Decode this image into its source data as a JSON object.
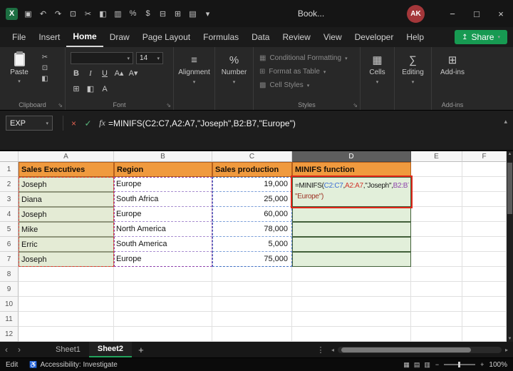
{
  "colors": {
    "header_fill": "#F09A3E",
    "header_border": "#B45F1D",
    "name_fill": "#E4EBD5",
    "result_fill": "#E2EFDA",
    "result_border": "#42603A",
    "ref_blue": "#4472C4",
    "ref_red": "#E23B2E",
    "ref_purple": "#8E44AD",
    "edit_border": "#E0261A",
    "share_green": "#179A52",
    "tab_active_green": "#23A35D",
    "avatar_red": "#A4373A"
  },
  "titlebar": {
    "app_glyph": "X",
    "workbook_name": "Book...",
    "avatar_initials": "AK",
    "window_controls": {
      "minimize": "−",
      "maximize": "□",
      "close": "×"
    },
    "qat": [
      {
        "name": "save-icon",
        "glyph": "▣"
      },
      {
        "name": "undo-icon",
        "glyph": "↶"
      },
      {
        "name": "redo-icon",
        "glyph": "↷"
      },
      {
        "name": "copy-icon",
        "glyph": "⊡"
      },
      {
        "name": "cut-icon",
        "glyph": "✂"
      },
      {
        "name": "format-painter-icon",
        "glyph": "◧"
      },
      {
        "name": "chart-icon",
        "glyph": "▥"
      },
      {
        "name": "percent-style-icon",
        "glyph": "%"
      },
      {
        "name": "currency-style-icon",
        "glyph": "$"
      },
      {
        "name": "merge-center-icon",
        "glyph": "⊟"
      },
      {
        "name": "borders-icon",
        "glyph": "⊞"
      },
      {
        "name": "table-icon",
        "glyph": "▤"
      },
      {
        "name": "more-commands-icon",
        "glyph": "▾"
      }
    ]
  },
  "menu": {
    "items": [
      "File",
      "Insert",
      "Home",
      "Draw",
      "Page Layout",
      "Formulas",
      "Data",
      "Review",
      "View",
      "Developer",
      "Help"
    ],
    "active": "Home",
    "share_label": "Share"
  },
  "ribbon": {
    "paste_label": "Paste",
    "font_name": "",
    "font_size": "14",
    "groups": {
      "clipboard": "Clipboard",
      "font": "Font",
      "alignment": "Alignment",
      "number": "Number",
      "styles": "Styles",
      "cells": "Cells",
      "editing": "Editing",
      "addins": "Add-ins"
    },
    "clipboard_icons": [
      {
        "name": "cut-icon",
        "glyph": "✂"
      },
      {
        "name": "copy-icon",
        "glyph": "⊡"
      },
      {
        "name": "format-painter-icon",
        "glyph": "◧"
      }
    ],
    "font_row2": [
      {
        "name": "bold-button",
        "glyph": "B",
        "cls": "b"
      },
      {
        "name": "italic-button",
        "glyph": "I",
        "cls": "i"
      },
      {
        "name": "underline-button",
        "glyph": "U",
        "cls": "u"
      },
      {
        "name": "increase-font-icon",
        "glyph": "A▴"
      },
      {
        "name": "decrease-font-icon",
        "glyph": "A▾"
      }
    ],
    "font_row3": [
      {
        "name": "borders-icon",
        "glyph": "⊞"
      },
      {
        "name": "fill-color-icon",
        "glyph": "◧"
      },
      {
        "name": "font-color-icon",
        "glyph": "A"
      }
    ],
    "styles_buttons": [
      "Conditional Formatting",
      "Format as Table",
      "Cell Styles"
    ],
    "addins_button": "Add-ins"
  },
  "formula_bar": {
    "name_box": "EXP",
    "formula": "=MINIFS(C2:C7,A2:A7,\"Joseph\",B2:B7,\"Europe\")"
  },
  "grid": {
    "col_headers": [
      "A",
      "B",
      "C",
      "D",
      "E",
      "F"
    ],
    "row_headers": [
      "1",
      "2",
      "3",
      "4",
      "5",
      "6",
      "7",
      "8",
      "9",
      "10",
      "11",
      "12"
    ],
    "active_column": "D",
    "header_row": {
      "A": "Sales Executives",
      "B": "Region",
      "C": "Sales production",
      "D": "MINIFS function"
    },
    "records": [
      {
        "name": "Joseph",
        "region": "Europe",
        "sales": "19,000"
      },
      {
        "name": "Diana",
        "region": "South Africa",
        "sales": "25,000"
      },
      {
        "name": "Joseph",
        "region": "Europe",
        "sales": "60,000"
      },
      {
        "name": "Mike",
        "region": "North America",
        "sales": "78,000"
      },
      {
        "name": "Erric",
        "region": "South America",
        "sales": "5,000"
      },
      {
        "name": "Joseph",
        "region": "Europe",
        "sales": "75,000"
      }
    ],
    "formula_cell": {
      "lines": [
        [
          {
            "text": "=MINIFS(",
            "color": "#1a1a1a"
          },
          {
            "text": "C2:C7",
            "color": "#3b6cd4"
          },
          {
            "text": ",",
            "color": "#1a1a1a"
          },
          {
            "text": "A2:A7",
            "color": "#d0342c"
          },
          {
            "text": ",\"Joseph\",",
            "color": "#1a1a1a"
          },
          {
            "text": "B2:B7",
            "color": "#8e44ad"
          },
          {
            "text": ",",
            "color": "#1a1a1a"
          }
        ],
        [
          {
            "text": "\"Europe\")",
            "color": "#9c3022"
          }
        ]
      ]
    }
  },
  "sheet_tabs": {
    "tabs": [
      "Sheet1",
      "Sheet2"
    ],
    "active": "Sheet2",
    "add_label": "+"
  },
  "status_bar": {
    "mode": "Edit",
    "accessibility": "Accessibility: Investigate",
    "zoom": "100%",
    "view_icons": [
      {
        "name": "normal-view-icon",
        "glyph": "▦"
      },
      {
        "name": "page-layout-view-icon",
        "glyph": "▤"
      },
      {
        "name": "page-break-view-icon",
        "glyph": "▥"
      }
    ]
  }
}
